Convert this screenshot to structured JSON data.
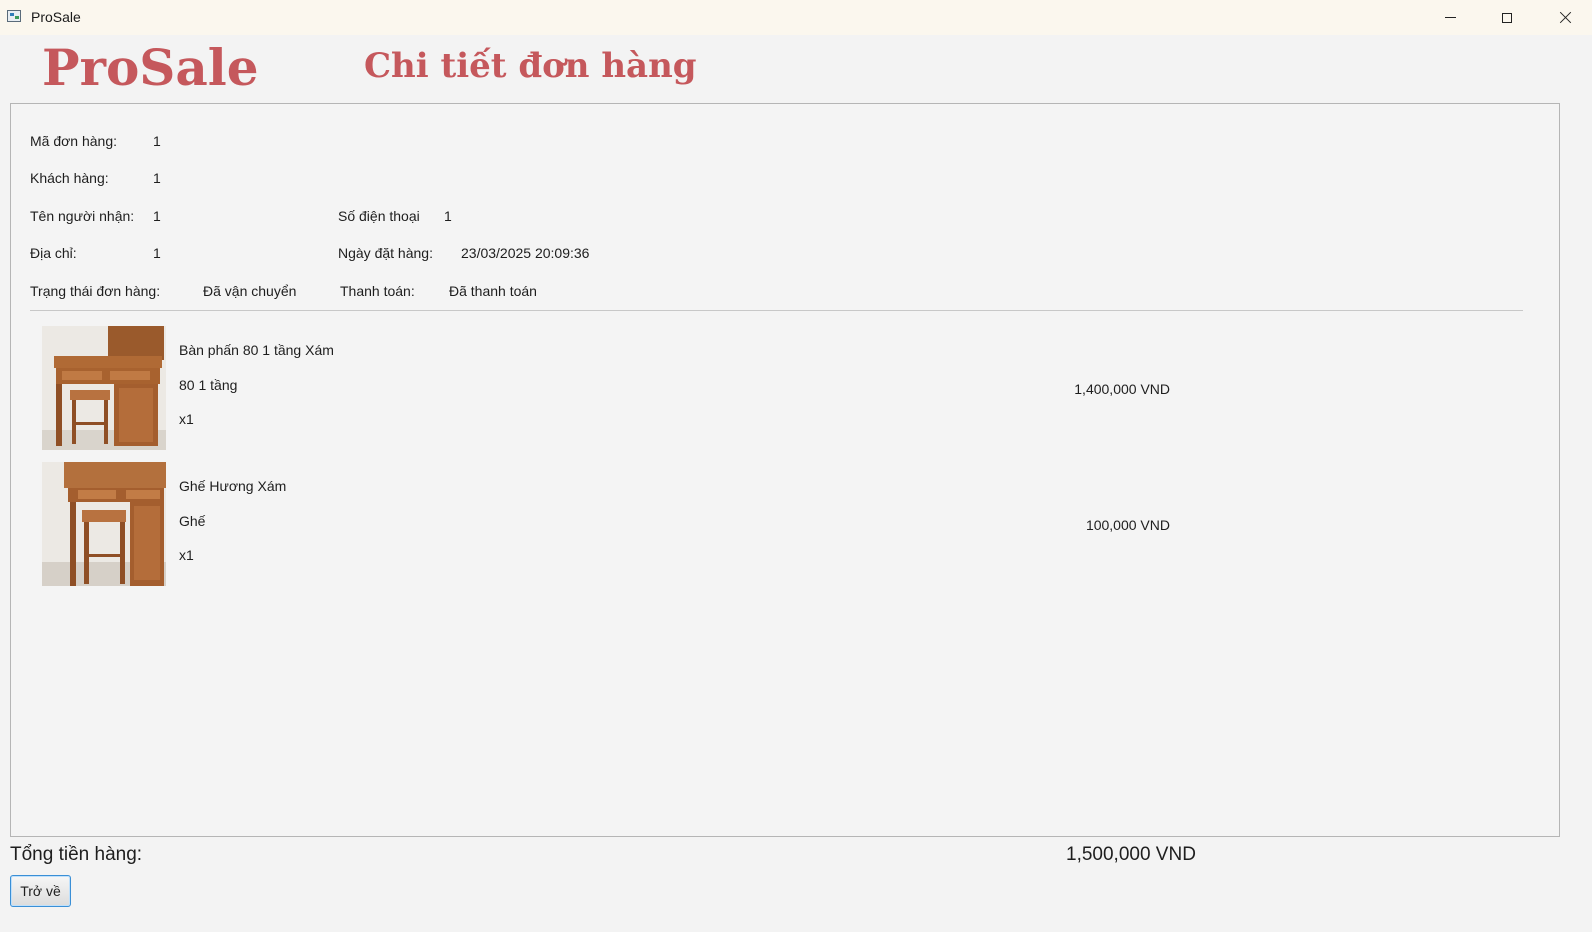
{
  "window": {
    "title": "ProSale"
  },
  "header": {
    "brand": "ProSale",
    "page_title": "Chi tiết đơn hàng"
  },
  "order": {
    "order_id_label": "Mã đơn hàng:",
    "order_id": "1",
    "customer_label": "Khách hàng:",
    "customer": "1",
    "recipient_label": "Tên người nhận:",
    "recipient": "1",
    "phone_label": "Số điện thoại",
    "phone": "1",
    "address_label": "Địa chỉ:",
    "address": "1",
    "order_date_label": "Ngày đặt hàng:",
    "order_date": "23/03/2025 20:09:36",
    "status_label": "Trạng thái đơn hàng:",
    "status": "Đã vận chuyển",
    "payment_label": "Thanh toán:",
    "payment": "Đã thanh toán"
  },
  "items": [
    {
      "name": "Bàn phấn 80 1 tầng Xám",
      "variant": "80 1 tầng",
      "quantity": "x1",
      "price": "1,400,000  VND"
    },
    {
      "name": "Ghế Hương Xám",
      "variant": "Ghế",
      "quantity": "x1",
      "price": "100,000  VND"
    }
  ],
  "footer": {
    "total_label": "Tổng tiền hàng:",
    "total_value": "1,500,000 VND",
    "back_label": "Trở về"
  }
}
